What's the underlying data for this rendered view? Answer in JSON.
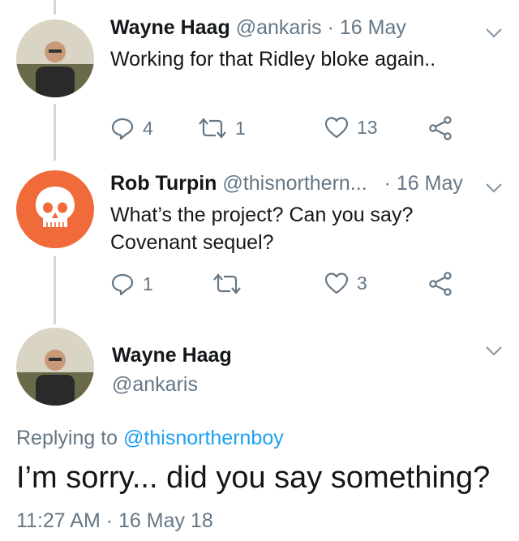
{
  "tweets": [
    {
      "name": "Wayne Haag",
      "handle": "@ankaris",
      "date": "· 16 May",
      "text": [
        "Working for that Ridley bloke again.."
      ],
      "reply_count": "4",
      "retweet_count": "1",
      "like_count": "13"
    },
    {
      "name": "Rob Turpin",
      "handle": "@thisnorthern...",
      "date": "· 16 May",
      "text": [
        "What’s the project? Can you say?",
        "Covenant sequel?"
      ],
      "reply_count": "1",
      "retweet_count": "",
      "like_count": "3"
    }
  ],
  "main_tweet": {
    "name": "Wayne Haag",
    "handle": "@ankaris",
    "replying_prefix": "Replying to",
    "replying_handle": "@thisnorthernboy",
    "text": "I’m sorry... did you say something?",
    "timestamp": "11:27 AM · 16 May 18"
  },
  "colors": {
    "link": "#1da1f2",
    "secondary_text": "#657786",
    "thread_line": "#ccd6dd",
    "skull_avatar_bg": "#f06a3a"
  },
  "icons": [
    "reply-icon",
    "retweet-icon",
    "like-icon",
    "share-icon",
    "chevron-down-icon"
  ]
}
